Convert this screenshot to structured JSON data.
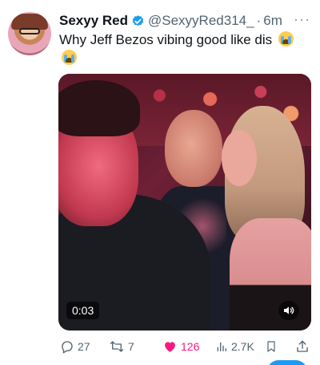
{
  "author": {
    "display_name": "Sexyy Red",
    "handle": "@SexyyRed314_",
    "separator": "·",
    "time": "6m",
    "verified": true
  },
  "tweet": {
    "text": "Why Jeff Bezos vibing good like dis"
  },
  "media": {
    "duration": "0:03"
  },
  "actions": {
    "replies": "27",
    "retweets": "7",
    "likes": "126",
    "views": "2.7K"
  },
  "colors": {
    "verified_blue": "#1d9bf0",
    "like_pink": "#f91880",
    "secondary_text": "#536471"
  },
  "icons": {
    "more": "more-dots-icon",
    "verified": "verified-badge-icon",
    "emoji": "loudly-crying-face-emoji",
    "volume": "volume-icon",
    "reply": "reply-icon",
    "retweet": "retweet-icon",
    "like": "heart-icon",
    "views": "views-icon",
    "bookmark": "bookmark-icon",
    "share": "share-icon"
  }
}
